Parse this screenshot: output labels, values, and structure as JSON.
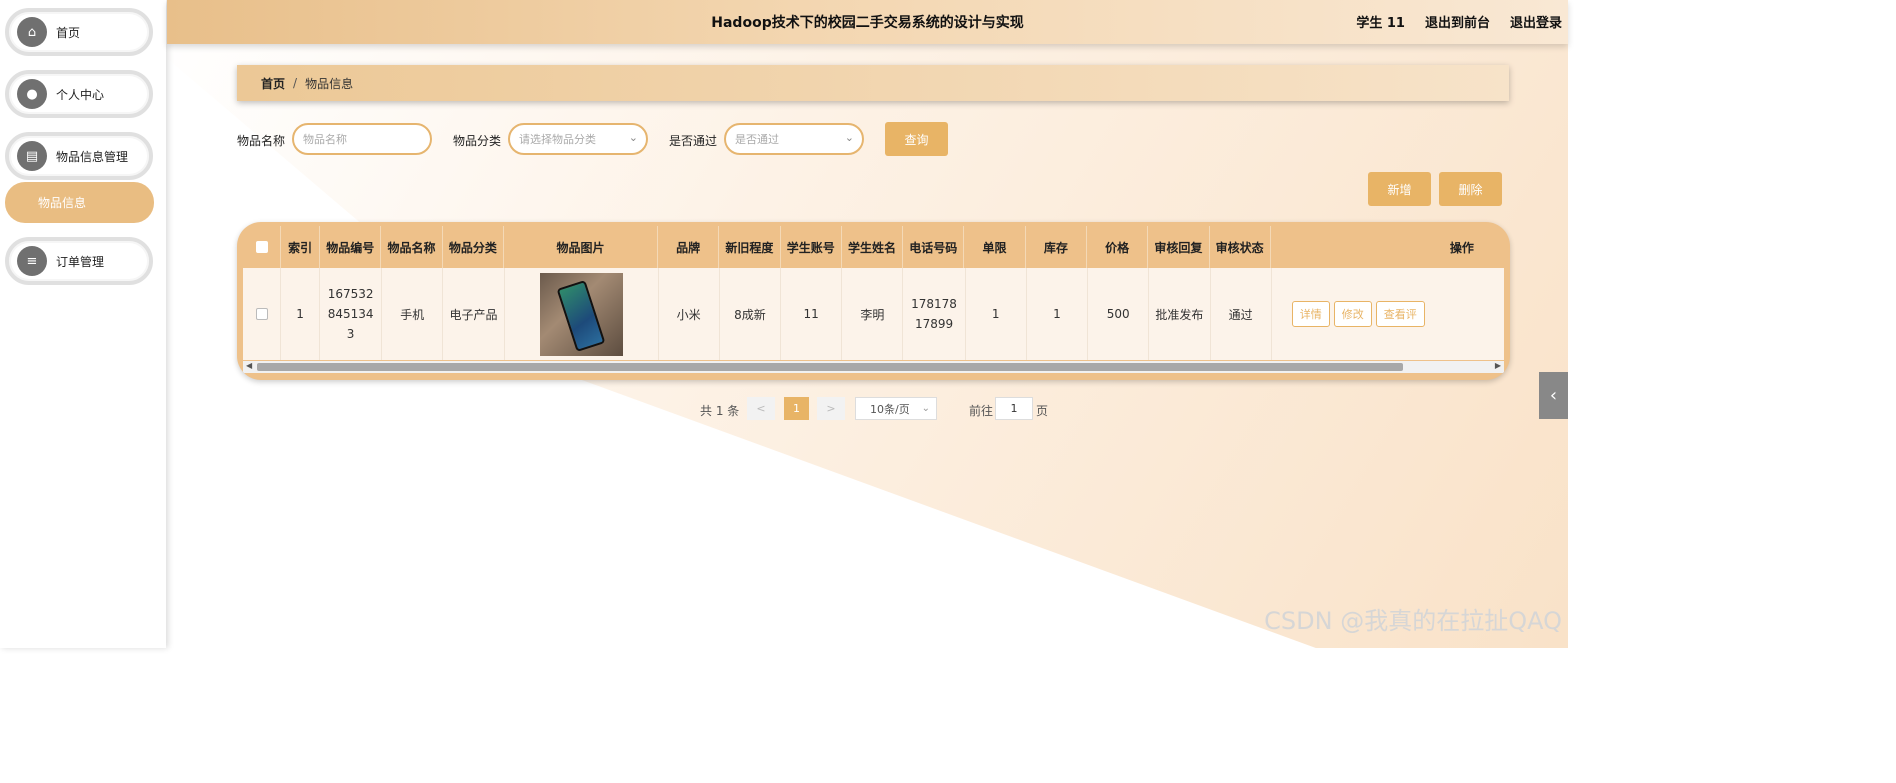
{
  "app_title": "Hadoop技术下的校园二手交易系统的设计与实现",
  "header_links": [
    "学生 11",
    "退出到前台",
    "退出登录"
  ],
  "sidebar": {
    "items": [
      {
        "label": "首页",
        "icon": "home-icon"
      },
      {
        "label": "个人中心",
        "icon": "user-icon"
      },
      {
        "label": "物品信息管理",
        "icon": "clipboard-icon"
      },
      {
        "label": "订单管理",
        "icon": "list-icon"
      }
    ],
    "active_sub": "物品信息"
  },
  "breadcrumb": {
    "home": "首页",
    "separator": "/",
    "current": "物品信息"
  },
  "search": {
    "name_label": "物品名称",
    "name_placeholder": "物品名称",
    "category_label": "物品分类",
    "category_placeholder": "请选择物品分类",
    "approved_label": "是否通过",
    "approved_placeholder": "是否通过",
    "query_button": "查询"
  },
  "actions": {
    "add": "新增",
    "delete": "删除"
  },
  "table": {
    "headers": [
      "索引",
      "物品编号",
      "物品名称",
      "物品分类",
      "物品图片",
      "品牌",
      "新旧程度",
      "学生账号",
      "学生姓名",
      "电话号码",
      "单限",
      "库存",
      "价格",
      "审核回复",
      "审核状态",
      "操作"
    ],
    "rows": [
      {
        "index": "1",
        "code": "1675328451343",
        "name": "手机",
        "category": "电子产品",
        "brand": "小米",
        "condition": "8成新",
        "student_account": "11",
        "student_name": "李明",
        "phone": "17817817899",
        "limit": "1",
        "stock": "1",
        "price": "500",
        "review_reply": "批准发布",
        "review_status": "通过"
      }
    ],
    "op_buttons": [
      "详情",
      "修改",
      "查看评"
    ]
  },
  "pagination": {
    "total": "共 1 条",
    "prev": "<",
    "page": "1",
    "next": ">",
    "page_size": "10条/页",
    "goto_label": "前往",
    "goto_value": "1",
    "page_suffix": "页"
  },
  "watermark": "CSDN @我真的在拉扯QAQ",
  "colors": {
    "accent": "#e8b466",
    "header": "#e8bf8a",
    "sub_active": "#e9bd82"
  }
}
